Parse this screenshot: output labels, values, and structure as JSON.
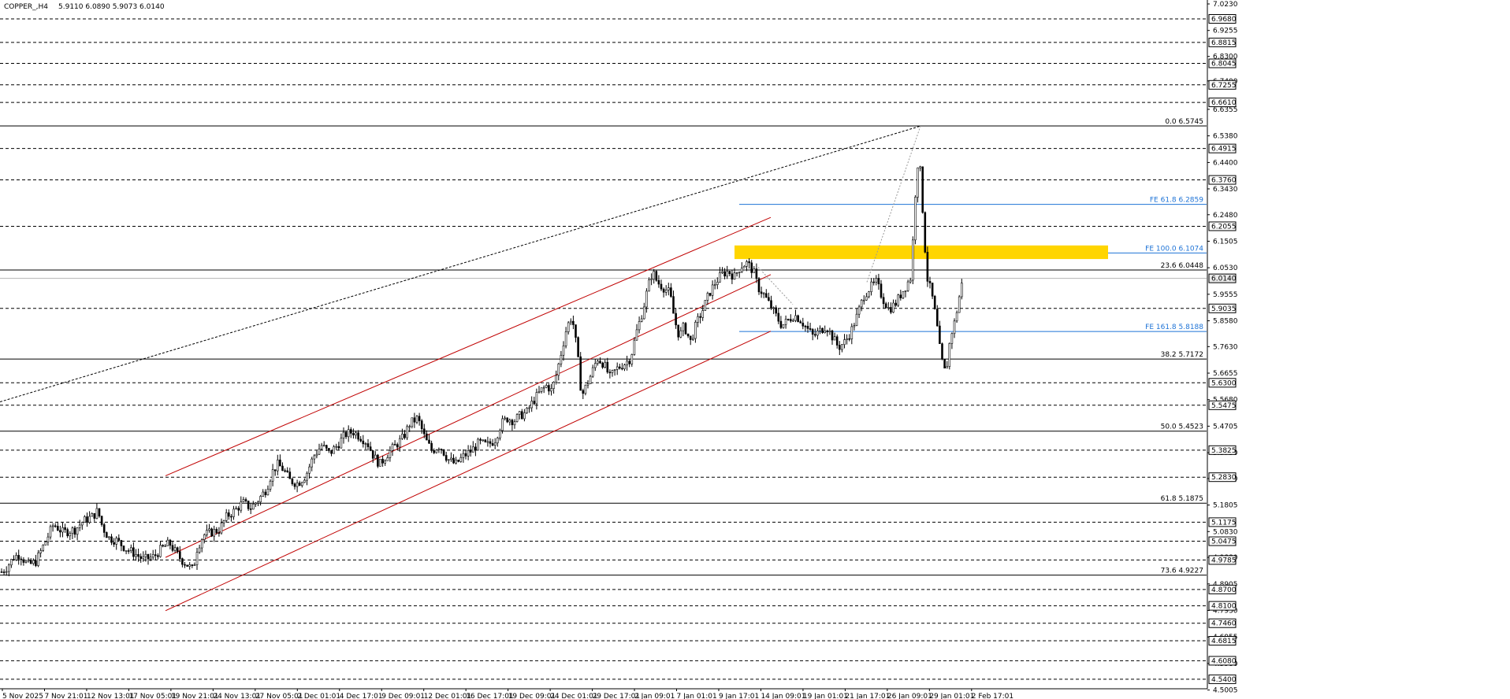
{
  "header": {
    "symbol": "COPPER_,H4",
    "ohlc": "5.9110 6.0890 5.9073 6.0140"
  },
  "chart_data": {
    "type": "candlestick",
    "ylim": [
      4.505,
      7.023
    ],
    "price_ticks": [
      "7.0230",
      "6.9255",
      "6.8300",
      "6.7400",
      "6.6355",
      "6.5380",
      "6.4400",
      "6.3430",
      "6.2480",
      "6.1505",
      "6.0530",
      "5.9555",
      "5.8580",
      "5.7630",
      "5.6655",
      "5.5680",
      "5.4705",
      "5.3730",
      "5.2780",
      "5.1805",
      "5.0830",
      "4.9880",
      "4.8905",
      "4.7930",
      "4.6955",
      "4.5980",
      "4.5005"
    ],
    "time_labels": [
      "5 Nov 2025",
      "7 Nov 21:01",
      "12 Nov 13:01",
      "17 Nov 05:01",
      "19 Nov 21:01",
      "24 Nov 13:01",
      "27 Nov 05:01",
      "2 Dec 01:01",
      "4 Dec 17:01",
      "9 Dec 09:01",
      "12 Dec 01:01",
      "16 Dec 17:01",
      "19 Dec 09:01",
      "24 Dec 01:01",
      "29 Dec 17:01",
      "2 Jan 09:01",
      "7 Jan 01:01",
      "9 Jan 17:01",
      "14 Jan 09:01",
      "19 Jan 01:01",
      "21 Jan 17:01",
      "26 Jan 09:01",
      "29 Jan 01:01",
      "2 Feb 17:01"
    ],
    "level_tags": [
      {
        "value": 6.968,
        "text": "6.9680"
      },
      {
        "value": 6.8815,
        "text": "6.8815"
      },
      {
        "value": 6.8045,
        "text": "6.8045"
      },
      {
        "value": 6.7255,
        "text": "6.7255"
      },
      {
        "value": 6.661,
        "text": "6.6610"
      },
      {
        "value": 6.4915,
        "text": "6.4915"
      },
      {
        "value": 6.376,
        "text": "6.3760"
      },
      {
        "value": 6.2055,
        "text": "6.2055"
      },
      {
        "value": 6.014,
        "text": "6.0140"
      },
      {
        "value": 5.9035,
        "text": "5.9035"
      },
      {
        "value": 5.63,
        "text": "5.6300"
      },
      {
        "value": 5.5475,
        "text": "5.5475"
      },
      {
        "value": 5.3825,
        "text": "5.3825"
      },
      {
        "value": 5.283,
        "text": "5.2830"
      },
      {
        "value": 5.1175,
        "text": "5.1175"
      },
      {
        "value": 5.0475,
        "text": "5.0475"
      },
      {
        "value": 4.9785,
        "text": "4.9785"
      },
      {
        "value": 4.87,
        "text": "4.8700"
      },
      {
        "value": 4.81,
        "text": "4.8100"
      },
      {
        "value": 4.746,
        "text": "4.7460"
      },
      {
        "value": 4.6815,
        "text": "4.6815"
      },
      {
        "value": 4.608,
        "text": "4.6080"
      },
      {
        "value": 4.54,
        "text": "4.5400"
      }
    ],
    "fib_levels": [
      {
        "value": 6.5745,
        "text": "0.0 6.5745"
      },
      {
        "value": 6.0448,
        "text": "23.6 6.0448"
      },
      {
        "value": 5.7172,
        "text": "38.2 5.7172"
      },
      {
        "value": 5.4523,
        "text": "50.0 5.4523"
      },
      {
        "value": 5.1875,
        "text": "61.8 5.1875"
      },
      {
        "value": 4.9227,
        "text": "73.6 4.9227"
      }
    ],
    "fe_levels": [
      {
        "value": 6.2859,
        "text": "FE 61.8 6.2859"
      },
      {
        "value": 6.1074,
        "text": "FE 100.0 6.1074"
      },
      {
        "value": 5.8188,
        "text": "FE 161.8 5.8188"
      }
    ],
    "current_price": 6.014,
    "resistance_zone": {
      "from": 6.085,
      "to": 6.135
    },
    "colors": {
      "bull": "#ffffff",
      "bear": "#000000",
      "channel": "#c00000",
      "fe": "#1e73d6",
      "zone": "#ffd500",
      "grid": "#000000"
    },
    "path": [
      [
        0,
        4.93
      ],
      [
        8,
        4.95
      ],
      [
        18,
        4.99
      ],
      [
        25,
        5.0
      ],
      [
        35,
        4.96
      ],
      [
        45,
        4.97
      ],
      [
        55,
        5.03
      ],
      [
        68,
        5.11
      ],
      [
        80,
        5.08
      ],
      [
        95,
        5.09
      ],
      [
        105,
        5.12
      ],
      [
        118,
        5.14
      ],
      [
        124,
        5.16
      ],
      [
        130,
        5.1
      ],
      [
        138,
        5.06
      ],
      [
        148,
        5.05
      ],
      [
        160,
        5.02
      ],
      [
        172,
        5.0
      ],
      [
        182,
        4.98
      ],
      [
        195,
        4.99
      ],
      [
        205,
        5.02
      ],
      [
        215,
        5.04
      ],
      [
        222,
        5.01
      ],
      [
        230,
        4.98
      ],
      [
        238,
        4.96
      ],
      [
        245,
        4.94
      ],
      [
        250,
        5.02
      ],
      [
        258,
        5.07
      ],
      [
        268,
        5.08
      ],
      [
        278,
        5.09
      ],
      [
        288,
        5.14
      ],
      [
        298,
        5.16
      ],
      [
        308,
        5.19
      ],
      [
        318,
        5.17
      ],
      [
        328,
        5.2
      ],
      [
        338,
        5.24
      ],
      [
        345,
        5.3
      ],
      [
        352,
        5.33
      ],
      [
        360,
        5.31
      ],
      [
        368,
        5.27
      ],
      [
        378,
        5.26
      ],
      [
        388,
        5.29
      ],
      [
        398,
        5.36
      ],
      [
        408,
        5.4
      ],
      [
        418,
        5.37
      ],
      [
        428,
        5.4
      ],
      [
        438,
        5.44
      ],
      [
        448,
        5.45
      ],
      [
        458,
        5.43
      ],
      [
        466,
        5.41
      ],
      [
        474,
        5.36
      ],
      [
        482,
        5.33
      ],
      [
        492,
        5.37
      ],
      [
        502,
        5.4
      ],
      [
        512,
        5.43
      ],
      [
        520,
        5.48
      ],
      [
        530,
        5.5
      ],
      [
        540,
        5.42
      ],
      [
        548,
        5.38
      ],
      [
        558,
        5.4
      ],
      [
        568,
        5.35
      ],
      [
        578,
        5.33
      ],
      [
        588,
        5.36
      ],
      [
        598,
        5.38
      ],
      [
        608,
        5.41
      ],
      [
        618,
        5.4
      ],
      [
        628,
        5.42
      ],
      [
        636,
        5.48
      ],
      [
        644,
        5.5
      ],
      [
        652,
        5.49
      ],
      [
        660,
        5.51
      ],
      [
        668,
        5.52
      ],
      [
        676,
        5.56
      ],
      [
        686,
        5.6
      ],
      [
        694,
        5.62
      ],
      [
        700,
        5.6
      ],
      [
        706,
        5.66
      ],
      [
        712,
        5.74
      ],
      [
        718,
        5.82
      ],
      [
        724,
        5.87
      ],
      [
        728,
        5.84
      ],
      [
        734,
        5.7
      ],
      [
        738,
        5.58
      ],
      [
        744,
        5.62
      ],
      [
        750,
        5.66
      ],
      [
        758,
        5.72
      ],
      [
        766,
        5.7
      ],
      [
        774,
        5.65
      ],
      [
        782,
        5.68
      ],
      [
        792,
        5.7
      ],
      [
        800,
        5.72
      ],
      [
        808,
        5.82
      ],
      [
        816,
        5.9
      ],
      [
        822,
        5.98
      ],
      [
        828,
        6.04
      ],
      [
        834,
        6.0
      ],
      [
        842,
        5.98
      ],
      [
        850,
        5.96
      ],
      [
        856,
        5.86
      ],
      [
        862,
        5.8
      ],
      [
        868,
        5.84
      ],
      [
        876,
        5.78
      ],
      [
        884,
        5.85
      ],
      [
        892,
        5.9
      ],
      [
        900,
        5.96
      ],
      [
        908,
        6.0
      ],
      [
        916,
        6.03
      ],
      [
        924,
        6.04
      ],
      [
        932,
        6.02
      ],
      [
        940,
        6.06
      ],
      [
        948,
        6.07
      ],
      [
        956,
        6.04
      ],
      [
        962,
        5.98
      ],
      [
        968,
        5.96
      ],
      [
        976,
        5.92
      ],
      [
        984,
        5.88
      ],
      [
        992,
        5.84
      ],
      [
        1000,
        5.86
      ],
      [
        1008,
        5.88
      ],
      [
        1016,
        5.86
      ],
      [
        1024,
        5.83
      ],
      [
        1032,
        5.8
      ],
      [
        1040,
        5.82
      ],
      [
        1048,
        5.84
      ],
      [
        1056,
        5.8
      ],
      [
        1064,
        5.76
      ],
      [
        1072,
        5.78
      ],
      [
        1080,
        5.82
      ],
      [
        1088,
        5.88
      ],
      [
        1096,
        5.95
      ],
      [
        1104,
        5.98
      ],
      [
        1112,
        6.0
      ],
      [
        1120,
        5.94
      ],
      [
        1128,
        5.9
      ],
      [
        1136,
        5.92
      ],
      [
        1144,
        5.96
      ],
      [
        1150,
        5.99
      ],
      [
        1156,
        6.02
      ],
      [
        1162,
        6.36
      ],
      [
        1166,
        6.48
      ],
      [
        1170,
        6.3
      ],
      [
        1176,
        6.02
      ],
      [
        1182,
        5.96
      ],
      [
        1188,
        5.86
      ],
      [
        1194,
        5.72
      ],
      [
        1200,
        5.66
      ],
      [
        1206,
        5.8
      ],
      [
        1212,
        5.86
      ],
      [
        1218,
        5.96
      ],
      [
        1222,
        6.014
      ]
    ],
    "drawn_lines": {
      "long_trendline": [
        [
          0,
          5.56
        ],
        [
          1168,
          6.574
        ]
      ],
      "channel_upper": [
        [
          210,
          5.288
        ],
        [
          978,
          6.238
        ]
      ],
      "channel_mid": [
        [
          210,
          4.988
        ],
        [
          978,
          6.028
        ]
      ],
      "channel_lower": [
        [
          210,
          4.792
        ],
        [
          978,
          5.82
        ]
      ],
      "fe_leg_1": [
        [
          962,
          6.055
        ],
        [
          1006,
          5.918
        ]
      ],
      "fe_leg_2": [
        [
          1100,
          6.0
        ],
        [
          1168,
          6.574
        ]
      ]
    }
  }
}
